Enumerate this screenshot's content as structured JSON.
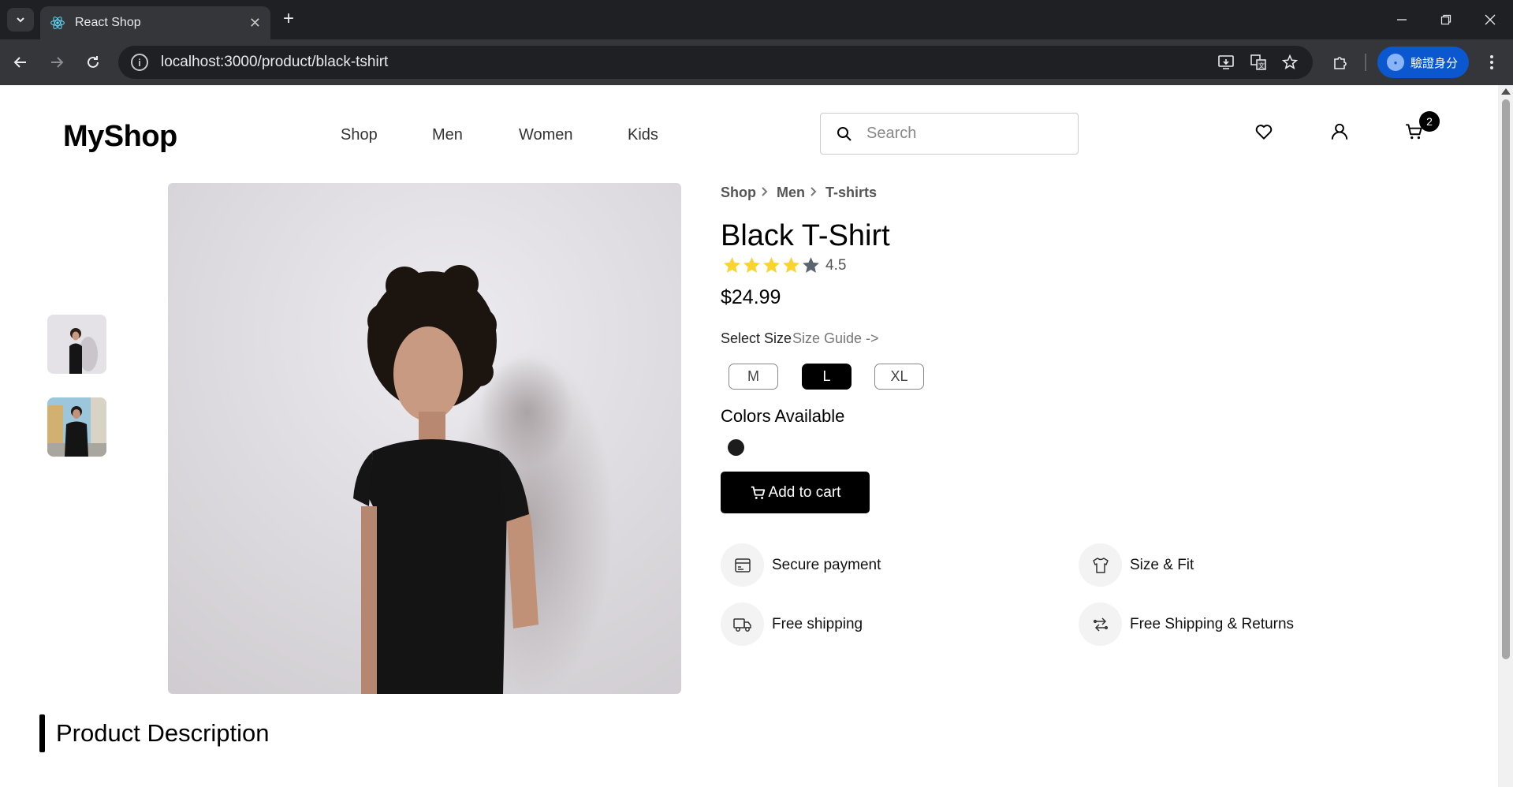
{
  "browser": {
    "tab_title": "React Shop",
    "url": "localhost:3000/product/black-tshirt",
    "profile_label": "驗證身分"
  },
  "header": {
    "logo": "MyShop",
    "nav": [
      "Shop",
      "Men",
      "Women",
      "Kids"
    ],
    "search_placeholder": "Search",
    "cart_count": "2"
  },
  "breadcrumb": [
    "Shop",
    "Men",
    "T-shirts"
  ],
  "product": {
    "title": "Black T-Shirt",
    "rating": "4.5",
    "rating_value": 4.5,
    "rating_max": 5,
    "price": "$24.99",
    "select_size_label": "Select Size",
    "size_guide": "Size Guide ->",
    "sizes": [
      "M",
      "L",
      "XL"
    ],
    "selected_size": "L",
    "colors_label": "Colors Available",
    "colors": [
      "#1c1c1c"
    ],
    "add_to_cart": "Add to cart"
  },
  "features": [
    {
      "label": "Secure payment",
      "icon": "card-icon"
    },
    {
      "label": "Size & Fit",
      "icon": "shirt-icon"
    },
    {
      "label": "Free shipping",
      "icon": "truck-icon"
    },
    {
      "label": "Free Shipping & Returns",
      "icon": "returns-icon"
    }
  ],
  "section": {
    "description_title": "Product Description"
  },
  "colors_theme": {
    "star": "#f8d42c",
    "star_empty": "#5a6470",
    "accent": "#000000"
  }
}
